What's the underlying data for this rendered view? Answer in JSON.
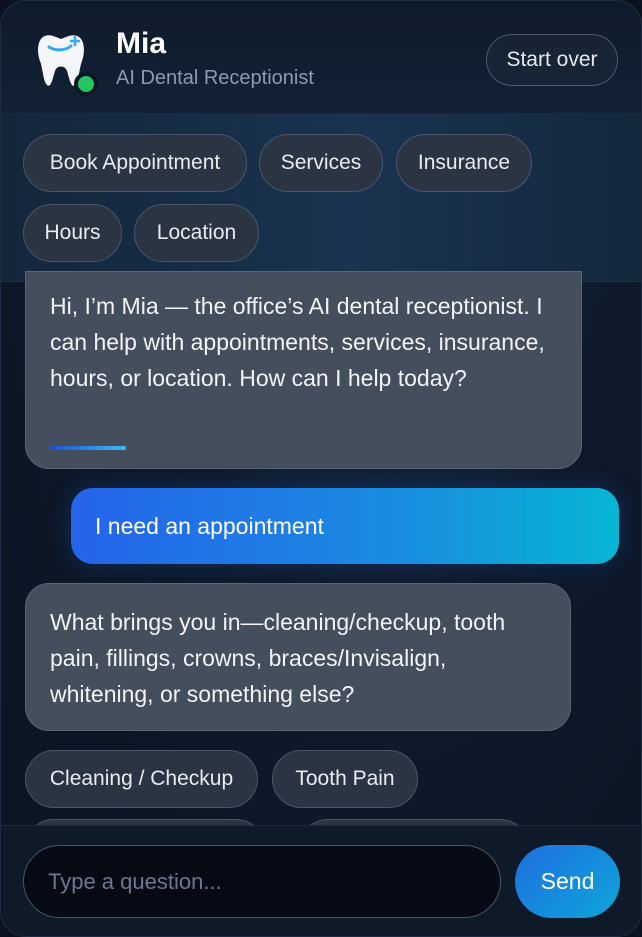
{
  "header": {
    "title": "Mia",
    "subtitle": "AI Dental Receptionist",
    "start_over_label": "Start over",
    "status": "online",
    "status_color": "#22c55e"
  },
  "quick_actions": [
    "Book Appointment",
    "Services",
    "Insurance",
    "Hours",
    "Location"
  ],
  "messages": [
    {
      "role": "bot",
      "text": "Hi, I’m Mia — the office’s AI dental receptionist. I can help with appointments, services, insurance, hours, or location. How can I help today?"
    },
    {
      "role": "user",
      "text": "I need an appointment"
    },
    {
      "role": "bot",
      "text": "What brings you in—cleaning/checkup, tooth pain, fillings, crowns, braces/Invisalign, whitening, or something else?"
    }
  ],
  "suggestions": [
    "Cleaning / Checkup",
    "Tooth Pain"
  ],
  "composer": {
    "placeholder": "Type a question...",
    "send_label": "Send"
  },
  "colors": {
    "accent_start": "#2563eb",
    "accent_end": "#06b6d4"
  }
}
